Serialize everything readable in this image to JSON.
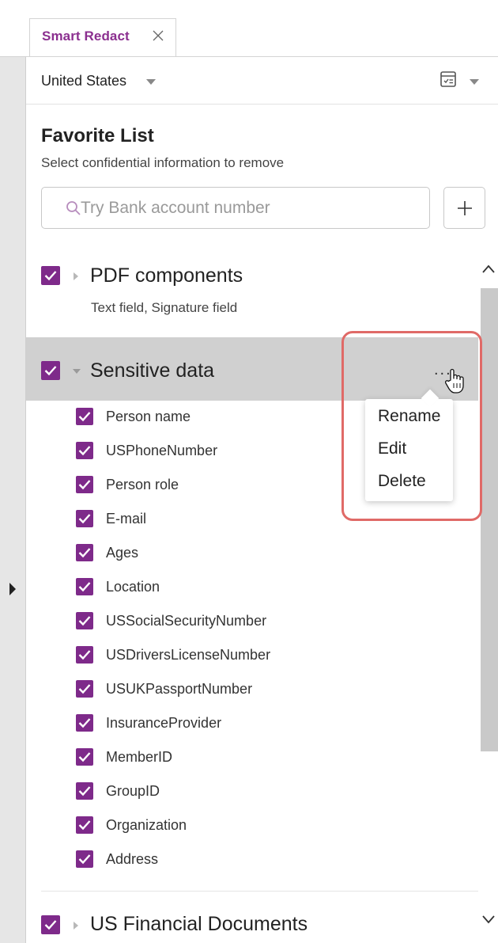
{
  "tab": {
    "label": "Smart Redact"
  },
  "region": {
    "selected": "United States"
  },
  "favorite": {
    "title": "Favorite List",
    "subtitle": "Select confidential information to remove"
  },
  "search": {
    "placeholder": "Try Bank account number",
    "value": ""
  },
  "add_button": {
    "label": "+"
  },
  "groups": {
    "pdf": {
      "label": "PDF components",
      "sub": "Text field, Signature field"
    },
    "sensitive": {
      "label": "Sensitive data"
    },
    "financial": {
      "label": "US Financial Documents"
    }
  },
  "items": [
    {
      "label": "Person name"
    },
    {
      "label": "USPhoneNumber"
    },
    {
      "label": "Person role"
    },
    {
      "label": "E-mail"
    },
    {
      "label": "Ages"
    },
    {
      "label": "Location"
    },
    {
      "label": "USSocialSecurityNumber"
    },
    {
      "label": "USDriversLicenseNumber"
    },
    {
      "label": "USUKPassportNumber"
    },
    {
      "label": "InsuranceProvider"
    },
    {
      "label": "MemberID"
    },
    {
      "label": "GroupID"
    },
    {
      "label": "Organization"
    },
    {
      "label": "Address"
    }
  ],
  "context_menu": {
    "more_label": "...",
    "rename": "Rename",
    "edit": "Edit",
    "delete": "Delete"
  },
  "colors": {
    "accent": "#7e2a8a",
    "tab_text": "#8b2f8f",
    "highlight_outline": "#e06a67",
    "selected_row": "#d0d0d0"
  }
}
